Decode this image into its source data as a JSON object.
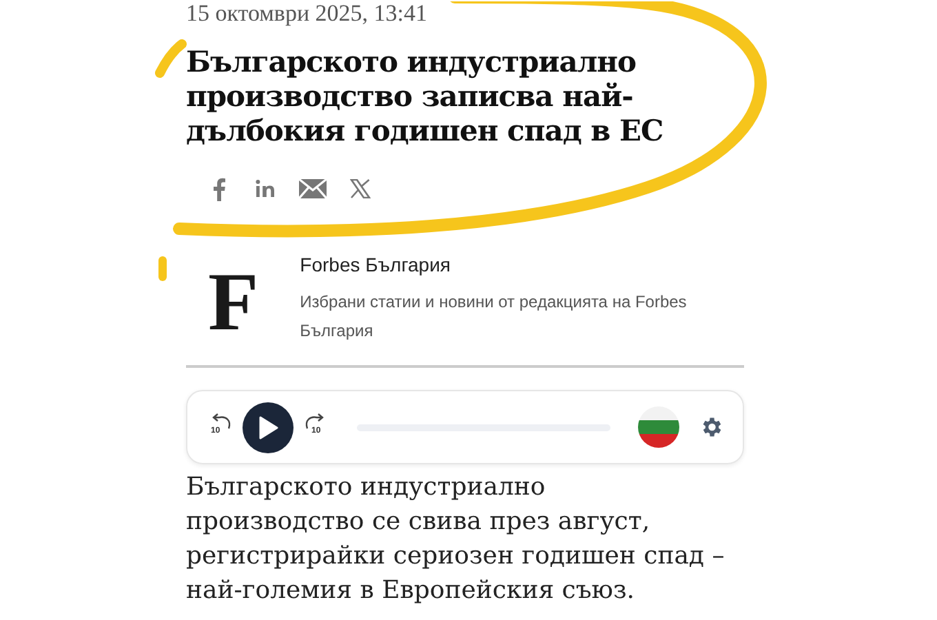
{
  "article": {
    "date": "15 октомври 2025, 13:41",
    "title": "Българското индустриално производство записва най-дълбокия годишен спад в ЕС",
    "share": [
      {
        "kind": "facebook"
      },
      {
        "kind": "linkedin"
      },
      {
        "kind": "email"
      },
      {
        "kind": "x"
      }
    ]
  },
  "author": {
    "logo": "F",
    "name": "Forbes България",
    "description": "Избрани статии и новини от редакцията на Forbes България"
  },
  "player": {
    "skip_back": "10",
    "skip_forward": "10",
    "playing": false,
    "progress": {
      "level": 0
    }
  },
  "body": "Българското индустриално производство се свива през август, регистрирайки сериозен годишен спад – най-големия в Европейския съюз."
}
